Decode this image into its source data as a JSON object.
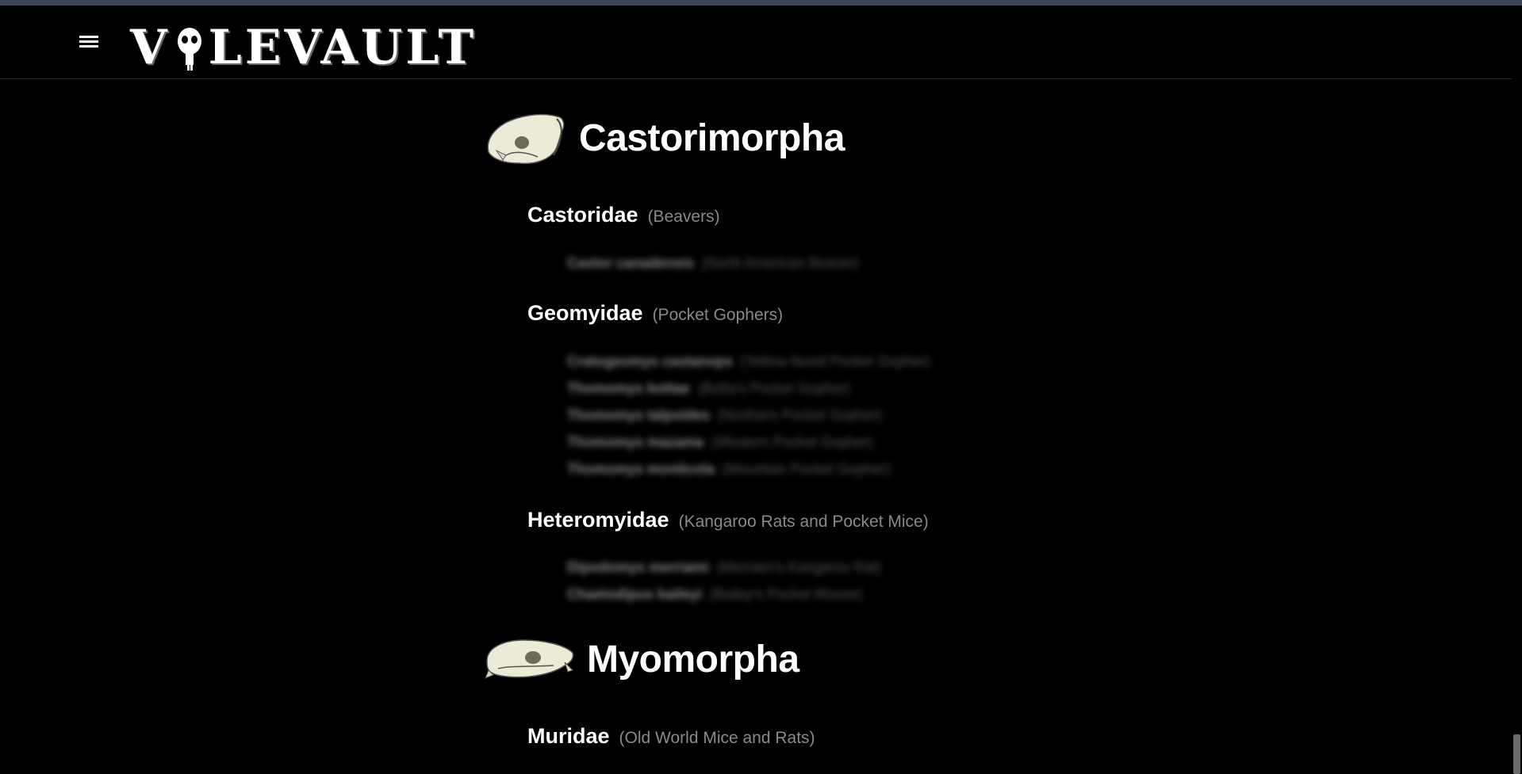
{
  "header": {
    "logo_text_left": "V",
    "logo_text_right": "LEVAULT",
    "menu_icon": "hamburger-menu-icon"
  },
  "orders": [
    {
      "name": "Castorimorpha",
      "icon": "beaver-skull-icon",
      "families": [
        {
          "name": "Castoridae",
          "common": "(Beavers)",
          "species": [
            {
              "name": "Castor canadensis",
              "common": "(North American Beaver)"
            }
          ]
        },
        {
          "name": "Geomyidae",
          "common": "(Pocket Gophers)",
          "species": [
            {
              "name": "Cratogeomys castanops",
              "common": "(Yellow-faced Pocket Gopher)"
            },
            {
              "name": "Thomomys bottae",
              "common": "(Botta's Pocket Gopher)"
            },
            {
              "name": "Thomomys talpoides",
              "common": "(Northern Pocket Gopher)"
            },
            {
              "name": "Thomomys mazama",
              "common": "(Western Pocket Gopher)"
            },
            {
              "name": "Thomomys monticola",
              "common": "(Mountain Pocket Gopher)"
            }
          ]
        },
        {
          "name": "Heteromyidae",
          "common": "(Kangaroo Rats and Pocket Mice)",
          "species": [
            {
              "name": "Dipodomys merriami",
              "common": "(Merriam's Kangaroo Rat)"
            },
            {
              "name": "Chaetodipus baileyi",
              "common": "(Bailey's Pocket Mouse)"
            }
          ]
        }
      ]
    },
    {
      "name": "Myomorpha",
      "icon": "rat-skull-icon",
      "families": [
        {
          "name": "Muridae",
          "common": "(Old World Mice and Rats)",
          "species": []
        }
      ]
    }
  ]
}
